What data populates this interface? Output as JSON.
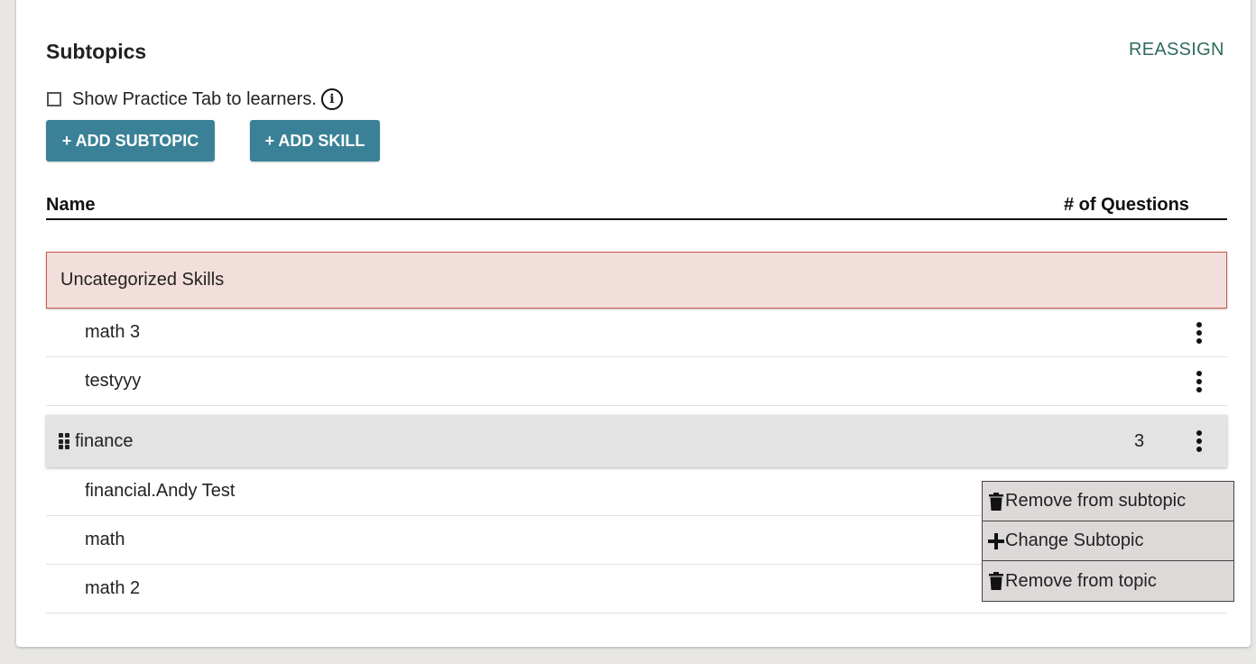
{
  "header": {
    "title": "Subtopics",
    "reassign_label": "REASSIGN"
  },
  "practice": {
    "label": "Show Practice Tab to learners.",
    "checked": false,
    "info_icon": "info-icon"
  },
  "buttons": {
    "add_subtopic": "+ ADD SUBTOPIC",
    "add_skill": "+ ADD SKILL"
  },
  "table": {
    "col_name": "Name",
    "col_questions": "# of Questions"
  },
  "uncategorized": {
    "label": "Uncategorized Skills",
    "skills": [
      {
        "name": "math 3"
      },
      {
        "name": "testyyy"
      }
    ]
  },
  "subtopic": {
    "name": "finance",
    "question_count": "3",
    "skills": [
      {
        "name": "financial.Andy Test"
      },
      {
        "name": "math"
      },
      {
        "name": "math 2"
      }
    ]
  },
  "context_menu": {
    "items": [
      {
        "label": "Remove from subtopic",
        "icon": "trash-icon"
      },
      {
        "label": "Change Subtopic",
        "icon": "plus-icon"
      },
      {
        "label": "Remove from topic",
        "icon": "trash-icon"
      }
    ]
  },
  "colors": {
    "primary_button": "#3a8197",
    "reassign_link": "#2e6b5e",
    "uncategorized_bg": "#f2dfdc",
    "uncategorized_border": "#c75a48",
    "subtopic_bg": "#e3e3e3",
    "menu_bg": "#ddd9d8"
  }
}
